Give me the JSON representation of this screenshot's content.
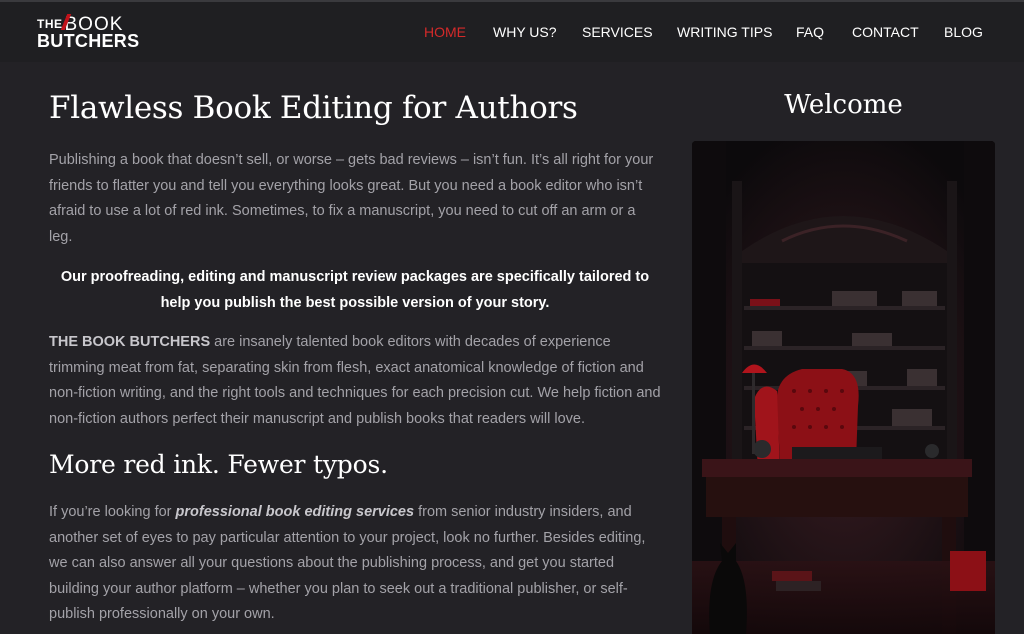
{
  "brand": {
    "logo_the": "THE",
    "logo_book": "BOOK",
    "logo_butchers": "BUTCHERS",
    "accent_color": "#c1121a"
  },
  "nav": {
    "items": [
      {
        "label": "HOME",
        "active": true
      },
      {
        "label": "WHY US?",
        "active": false
      },
      {
        "label": "SERVICES",
        "active": false
      },
      {
        "label": "WRITING TIPS",
        "active": false
      },
      {
        "label": "FAQ",
        "active": false
      },
      {
        "label": "CONTACT",
        "active": false
      },
      {
        "label": "BLOG",
        "active": false
      }
    ]
  },
  "main": {
    "title": "Flawless Book Editing for Authors",
    "intro": "Publishing a book that doesn’t sell, or worse – gets bad reviews – isn’t fun. It’s all right for your friends to flatter you and tell you everything looks great. But you need a book editor who isn’t afraid to use a lot of red ink. Sometimes, to fix a manuscript, you need to cut off an arm or a leg.",
    "tagline": "Our proofreading, editing and manuscript review packages are specifically tailored to help you publish the best possible version of your story.",
    "about_strong": "THE BOOK BUTCHERS",
    "about_rest": " are insanely talented book editors with decades of experience trimming meat from fat, separating skin from flesh, exact anatomical knowledge of fiction and non-fiction writing, and the right tools and techniques for each precision cut. We help fiction and non-fiction authors perfect their manuscript and publish books that readers will love.",
    "subtitle": "More red ink. Fewer typos.",
    "services_pre": "If you’re looking for ",
    "services_emph": "professional book editing services",
    "services_post": " from senior industry insiders, and another set of eyes to pay particular attention to your project, look no further. Besides editing, we can also answer all your questions about the publishing process, and get you started building your author platform – whether you  plan to seek out a traditional publisher, or self-publish professionally on your own."
  },
  "sidebar": {
    "welcome": "Welcome"
  }
}
